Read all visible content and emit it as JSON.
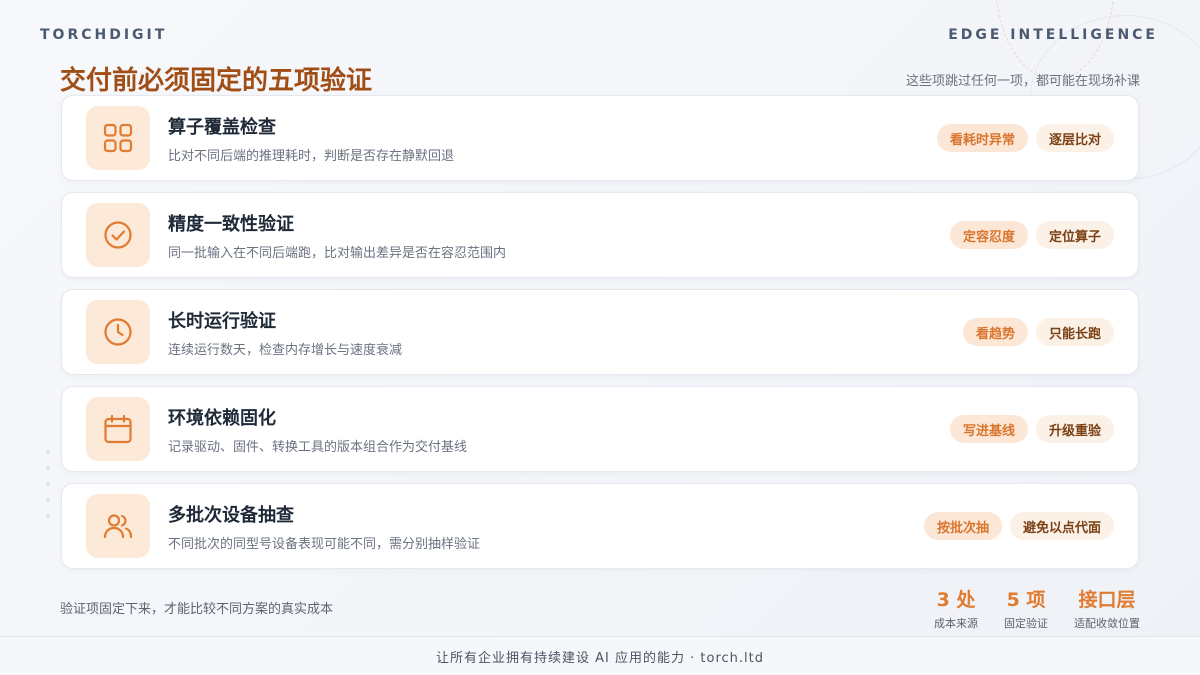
{
  "header": {
    "brand_left": "TORCHDIGIT",
    "brand_right": "EDGE INTELLIGENCE",
    "title": "交付前必须固定的五项验证",
    "subtitle": "这些项跳过任何一项，都可能在现场补课"
  },
  "accent_colors": {
    "title": "#a04e15",
    "icon": "#e07b30",
    "icon_bg": "#fde9d8"
  },
  "cards": [
    {
      "icon": "grid-icon",
      "title": "算子覆盖检查",
      "desc": "比对不同后端的推理耗时，判断是否存在静默回退",
      "tags": [
        "看耗时异常",
        "逐层比对"
      ]
    },
    {
      "icon": "check-circle-icon",
      "title": "精度一致性验证",
      "desc": "同一批输入在不同后端跑，比对输出差异是否在容忍范围内",
      "tags": [
        "定容忍度",
        "定位算子"
      ]
    },
    {
      "icon": "clock-icon",
      "title": "长时运行验证",
      "desc": "连续运行数天，检查内存增长与速度衰减",
      "tags": [
        "看趋势",
        "只能长跑"
      ]
    },
    {
      "icon": "calendar-icon",
      "title": "环境依赖固化",
      "desc": "记录驱动、固件、转换工具的版本组合作为交付基线",
      "tags": [
        "写进基线",
        "升级重验"
      ]
    },
    {
      "icon": "users-icon",
      "title": "多批次设备抽查",
      "desc": "不同批次的同型号设备表现可能不同，需分别抽样验证",
      "tags": [
        "按批次抽",
        "避免以点代面"
      ]
    }
  ],
  "footer": {
    "note": "验证项固定下来，才能比较不同方案的真实成本",
    "stats": [
      {
        "value": "3 处",
        "label": "成本来源"
      },
      {
        "value": "5 项",
        "label": "固定验证"
      },
      {
        "value": "接口层",
        "label": "适配收敛位置"
      }
    ],
    "tagline": "让所有企业拥有持续建设 AI 应用的能力 · torch.ltd"
  }
}
